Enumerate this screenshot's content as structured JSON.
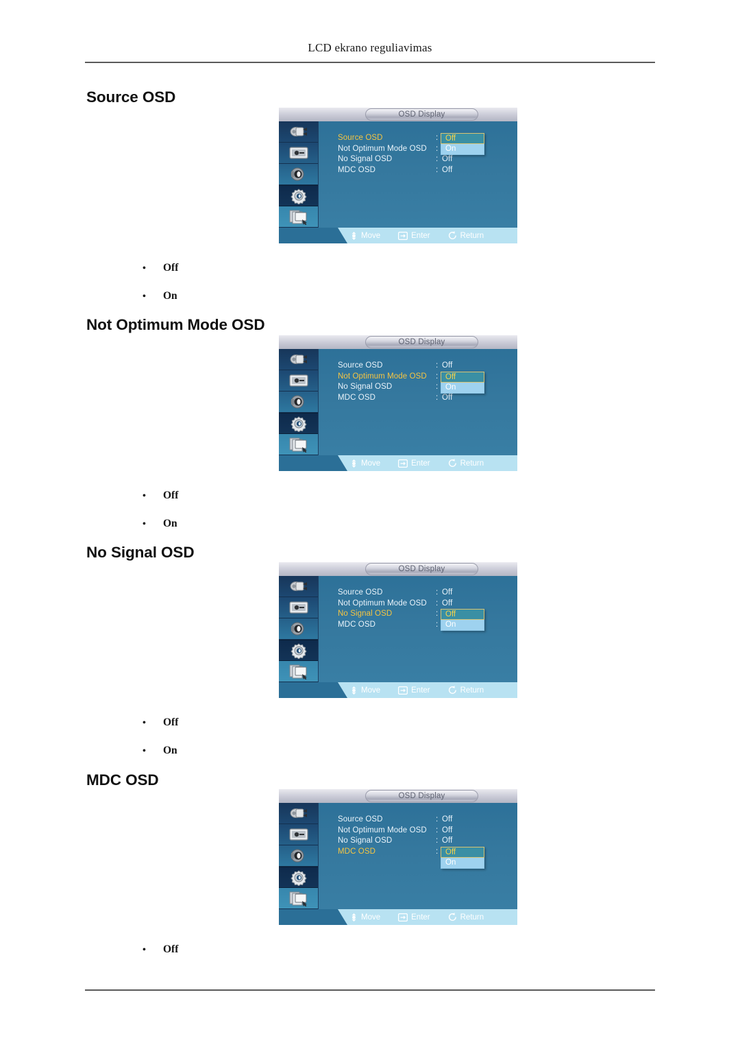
{
  "header": {
    "title": "LCD ekrano reguliavimas"
  },
  "sections": [
    {
      "heading": "Source OSD",
      "bullets": [
        "Off",
        "On"
      ]
    },
    {
      "heading": "Not Optimum Mode OSD",
      "bullets": [
        "Off",
        "On"
      ]
    },
    {
      "heading": "No Signal OSD",
      "bullets": [
        "Off",
        "On"
      ]
    },
    {
      "heading": "MDC OSD",
      "bullets": [
        "Off"
      ]
    }
  ],
  "osd": {
    "title": "OSD Display",
    "sidebar_icons": [
      "input-source-plug-icon",
      "picture-display-icon",
      "sound-speaker-icon",
      "setup-gear-icon",
      "multi-control-pages-icon"
    ],
    "active_sidebar_index": 3,
    "menu_labels": [
      "Source OSD",
      "Not Optimum Mode OSD",
      "No Signal OSD",
      "MDC OSD"
    ],
    "colon": ":",
    "dropdown_options": {
      "selected": "Off",
      "other": "On"
    },
    "hints": [
      {
        "icon": "move-dpad-icon",
        "label": "Move"
      },
      {
        "icon": "enter-arrow-icon",
        "label": "Enter"
      },
      {
        "icon": "return-undo-icon",
        "label": "Return"
      }
    ],
    "panels": [
      {
        "highlighted_index": 0,
        "values": [
          "Off",
          "Off",
          "Off",
          "Off"
        ]
      },
      {
        "highlighted_index": 1,
        "values": [
          "Off",
          "Off",
          "Off",
          "Off"
        ]
      },
      {
        "highlighted_index": 2,
        "values": [
          "Off",
          "Off",
          "Off",
          "Off"
        ]
      },
      {
        "highlighted_index": 3,
        "values": [
          "Off",
          "Off",
          "Off",
          "Off"
        ]
      }
    ]
  },
  "colors": {
    "osd_background": "#2e7399",
    "highlight_text": "#f5c542",
    "dropdown_selected_bg": "#3a8fa4",
    "dropdown_unselected_bg": "#9ed2ef",
    "bottom_bar": "#b8e2f2"
  }
}
